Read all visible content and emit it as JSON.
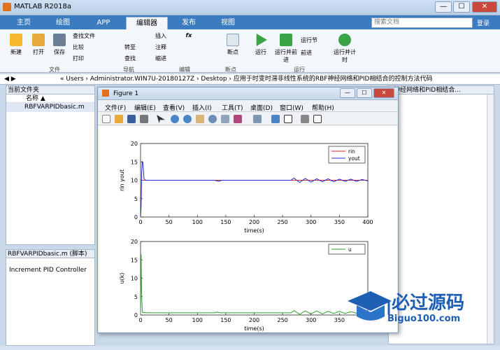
{
  "window": {
    "title": "MATLAB R2018a",
    "min": "—",
    "max": "☐",
    "close": "✕"
  },
  "tabs": [
    "主页",
    "绘图",
    "APP",
    "编辑器",
    "发布",
    "视图"
  ],
  "search": {
    "placeholder": "搜索文档"
  },
  "login": "登录",
  "ribbon": {
    "new": "新建",
    "open": "打开",
    "save": "保存",
    "find_files": "查找文件",
    "compare": "比较",
    "print": "打印",
    "goto": "转至",
    "find": "查找",
    "insert": "插入",
    "comment": "注释",
    "indent": "缩进",
    "fx": "fx",
    "breakpoint": "断点",
    "run": "运行",
    "run_advance": "运行并前进",
    "run_section": "运行节",
    "advance": "前进",
    "run_time": "运行并计时",
    "groups": [
      "文件",
      "导航",
      "编辑",
      "断点",
      "运行"
    ]
  },
  "address": {
    "path": "« Users › Administrator.WIN7U-20180127Z › Desktop › 应用于时变时滞非线性系统的RBF神经网络和PID相结合的控制方法代码"
  },
  "current_folder": {
    "header": "当前文件夹",
    "col_name": "名称 ▲",
    "file": "RBFVARPIDbasic.m"
  },
  "details": {
    "header": "RBFVARPIDbasic.m  (脚本)",
    "text": "Increment PID Controller"
  },
  "editor_right": {
    "text": "F神经网络和PID相结合..."
  },
  "figure": {
    "title": "Figure 1",
    "menu": [
      "文件(F)",
      "编辑(E)",
      "查看(V)",
      "插入(I)",
      "工具(T)",
      "桌面(D)",
      "窗口(W)",
      "帮助(H)"
    ]
  },
  "chart_data": [
    {
      "type": "line",
      "title": "",
      "xlabel": "time(s)",
      "ylabel": "rin yout",
      "xlim": [
        0,
        400
      ],
      "ylim": [
        0,
        20
      ],
      "xticks": [
        0,
        50,
        100,
        150,
        200,
        250,
        300,
        350,
        400
      ],
      "yticks": [
        0,
        5,
        10,
        15,
        20
      ],
      "legend_position": "top-right",
      "series": [
        {
          "name": "rin",
          "color": "#d62728",
          "x": [
            0,
            400
          ],
          "y": [
            10,
            10
          ]
        },
        {
          "name": "yout",
          "color": "#1f2bd6",
          "x": [
            0,
            1,
            2,
            3,
            4,
            5,
            6,
            8,
            10,
            15,
            130,
            135,
            138,
            140,
            145,
            265,
            270,
            280,
            290,
            300,
            310,
            320,
            330,
            340,
            350,
            360,
            370,
            380,
            390,
            400
          ],
          "y": [
            0,
            3,
            12,
            15.2,
            14.8,
            13,
            10.5,
            10.1,
            10,
            10,
            10,
            9.8,
            9.7,
            9.9,
            10,
            10,
            10.6,
            9.4,
            10.5,
            9.5,
            10.4,
            9.6,
            10.4,
            9.6,
            10.3,
            9.7,
            10.3,
            9.7,
            10.2,
            9.8
          ]
        }
      ]
    },
    {
      "type": "line",
      "title": "",
      "xlabel": "time(s)",
      "ylabel": "u(k)",
      "xlim": [
        0,
        400
      ],
      "ylim": [
        0,
        20
      ],
      "xticks": [
        0,
        50,
        100,
        150,
        200,
        250,
        300,
        350
      ],
      "yticks": [
        0,
        5,
        10,
        15,
        20
      ],
      "legend_position": "top-right",
      "series": [
        {
          "name": "u",
          "color": "#2ca02c",
          "x": [
            0,
            1,
            2,
            3,
            4,
            6,
            10,
            20,
            130,
            135,
            140,
            265,
            270,
            280,
            290,
            300,
            310,
            320,
            330,
            340,
            350,
            360,
            370,
            380,
            390
          ],
          "y": [
            0,
            16.5,
            5,
            1.2,
            0.6,
            0.7,
            0.6,
            0.6,
            0.6,
            0.8,
            0.6,
            0.6,
            1.2,
            0.2,
            1.1,
            0.3,
            1.1,
            0.3,
            1.0,
            0.4,
            1.0,
            0.4,
            0.9,
            0.5,
            0.9
          ]
        }
      ]
    }
  ],
  "watermark": {
    "text": "必过源码",
    "url": "Biguo100.com"
  }
}
